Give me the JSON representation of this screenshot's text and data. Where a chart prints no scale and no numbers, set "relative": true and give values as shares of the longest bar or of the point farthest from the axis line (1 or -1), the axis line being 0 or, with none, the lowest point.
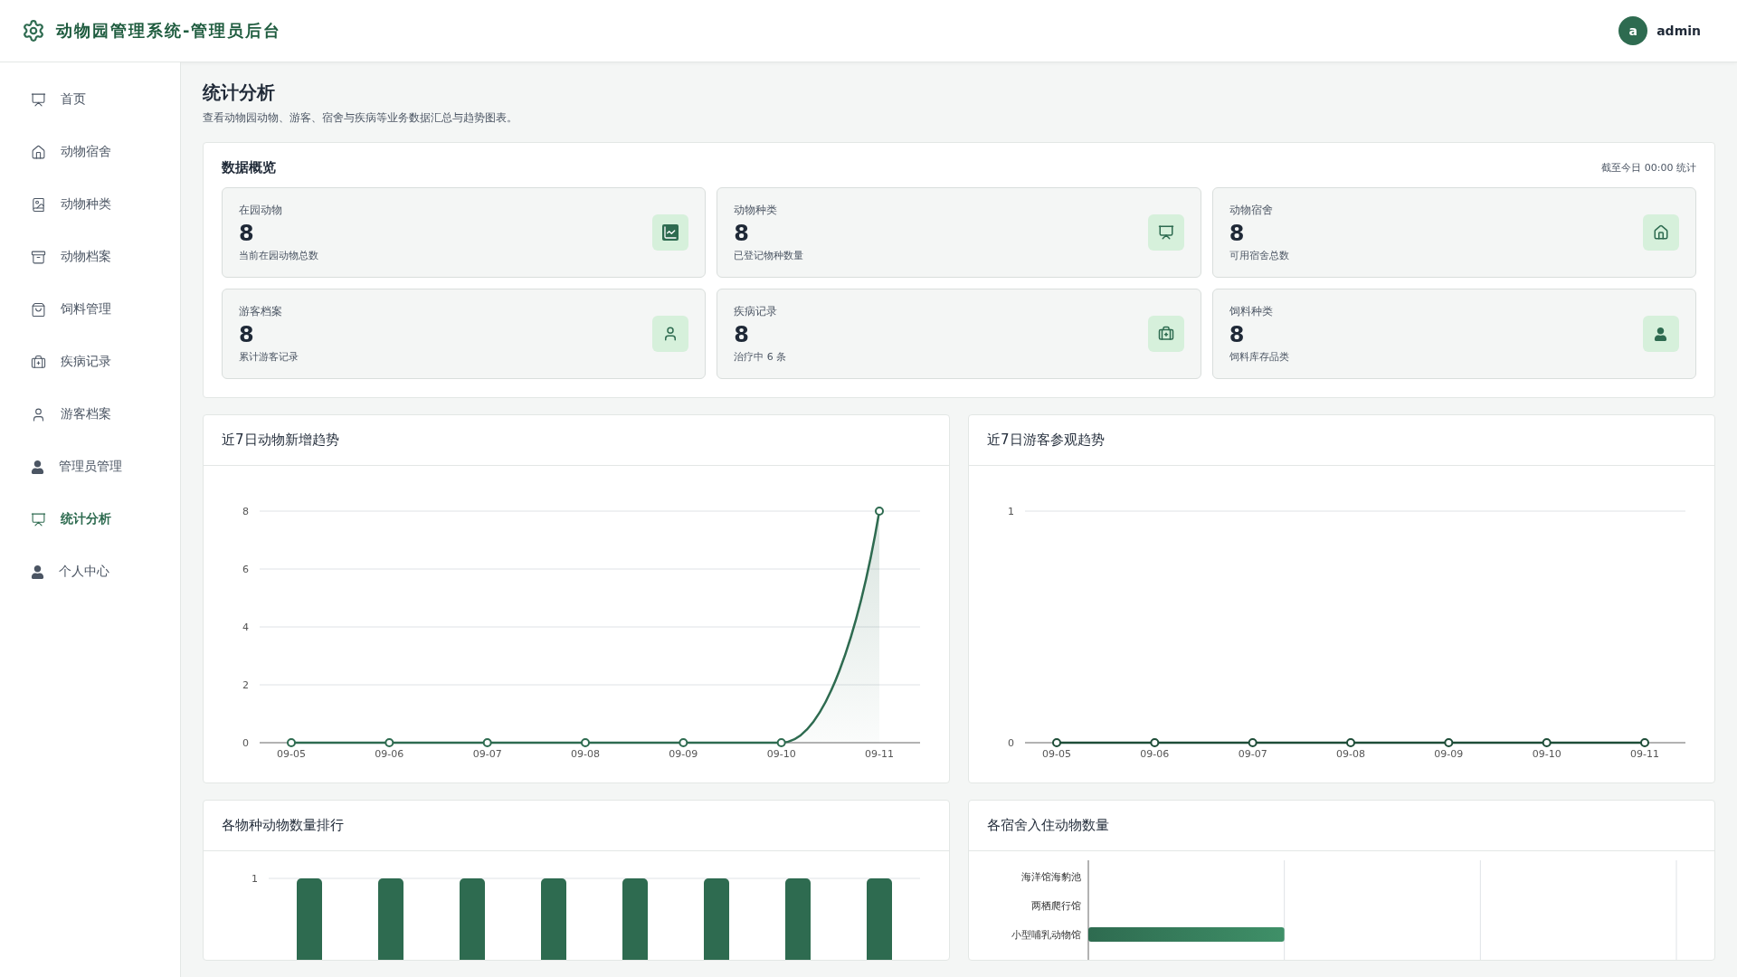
{
  "header": {
    "title": "动物园管理系统-管理员后台",
    "user": {
      "avatar_letter": "a",
      "name": "admin"
    }
  },
  "sidebar": {
    "items": [
      {
        "label": "首页",
        "selected": false
      },
      {
        "label": "动物宿舍",
        "selected": false
      },
      {
        "label": "动物种类",
        "selected": false
      },
      {
        "label": "动物档案",
        "selected": false
      },
      {
        "label": "饲料管理",
        "selected": false
      },
      {
        "label": "疾病记录",
        "selected": false
      },
      {
        "label": "游客档案",
        "selected": false
      },
      {
        "label": "管理员管理",
        "selected": false
      },
      {
        "label": "统计分析",
        "selected": true
      },
      {
        "label": "个人中心",
        "selected": false
      }
    ]
  },
  "page": {
    "title": "统计分析",
    "subtitle": "查看动物园动物、游客、宿舍与疾病等业务数据汇总与趋势图表。"
  },
  "overview": {
    "title": "数据概览",
    "note": "截至今日 00:00 统计",
    "cards": [
      {
        "label": "在园动物",
        "value": "8",
        "caption": "当前在园动物总数"
      },
      {
        "label": "动物种类",
        "value": "8",
        "caption": "已登记物种数量"
      },
      {
        "label": "动物宿舍",
        "value": "8",
        "caption": "可用宿舍总数"
      },
      {
        "label": "游客档案",
        "value": "8",
        "caption": "累计游客记录"
      },
      {
        "label": "疾病记录",
        "value": "8",
        "caption": "治疗中 6 条"
      },
      {
        "label": "饲料种类",
        "value": "8",
        "caption": "饲料库存品类"
      }
    ]
  },
  "charts": [
    {
      "title": "近7日动物新增趋势",
      "chart_data": {
        "type": "area",
        "categories": [
          "09-05",
          "09-06",
          "09-07",
          "09-08",
          "09-09",
          "09-10",
          "09-11"
        ],
        "series": [
          {
            "color": "#2e6b50",
            "marker": true,
            "values": [
              0,
              0,
              0,
              0,
              0,
              0,
              8
            ]
          }
        ],
        "ylim": [
          0,
          8
        ],
        "yticks": [
          0,
          2,
          4,
          6,
          8
        ],
        "grid": true
      }
    },
    {
      "title": "近7日游客参观趋势",
      "chart_data": {
        "type": "line",
        "categories": [
          "09-05",
          "09-06",
          "09-07",
          "09-08",
          "09-09",
          "09-10",
          "09-11"
        ],
        "series": [
          {
            "color": "#1e4d38",
            "marker": true,
            "values": [
              0,
              0,
              0,
              0,
              0,
              0,
              0
            ]
          }
        ],
        "ylim": [
          0,
          1
        ],
        "yticks": [
          0,
          1
        ],
        "grid": true
      }
    },
    {
      "title": "各物种动物数量排行",
      "axis_top_label": "1",
      "chart_data": {
        "type": "bar",
        "orientation": "vertical",
        "relative": true,
        "series": [
          {
            "color": "#2e6b50",
            "values": [
              1,
              1,
              1,
              1,
              1,
              1,
              1,
              1
            ]
          }
        ]
      }
    },
    {
      "title": "各宿舍入住动物数量",
      "chart_data": {
        "type": "bar",
        "orientation": "horizontal",
        "categories": [
          "海洋馆海豹池",
          "两栖爬行馆",
          "小型哺乳动物馆"
        ],
        "relative": true,
        "series": [
          {
            "color": "#2e6b50",
            "values": [
              0,
              0,
              1
            ]
          }
        ]
      }
    }
  ]
}
